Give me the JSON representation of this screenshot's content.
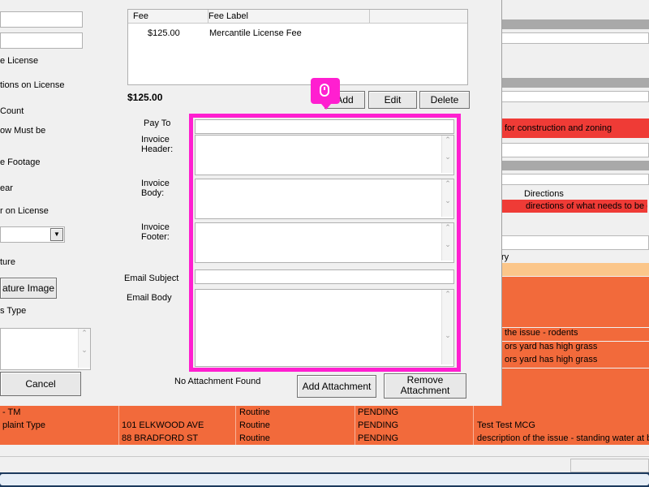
{
  "left_panel": {
    "labels": [
      "e License",
      "tions on License",
      "Count",
      "ow Must be",
      "e Footage",
      "ear",
      "r on License",
      "ture",
      "s Type"
    ],
    "feature_image_button": "ature Image",
    "cancel_button": "Cancel"
  },
  "fee_table": {
    "headers": [
      "Fee",
      "Fee Label",
      ""
    ],
    "rows": [
      {
        "fee": "$125.00",
        "label": "Mercantile License Fee"
      }
    ]
  },
  "total": "$125.00",
  "buttons": {
    "add": "Add",
    "edit": "Edit",
    "delete": "Delete",
    "add_attachment": "Add Attachment",
    "remove_attachment": "Remove Attachment"
  },
  "form": {
    "pay_to": "Pay To",
    "invoice_header": "Invoice Header:",
    "invoice_body": "Invoice Body:",
    "invoice_footer": "Invoice Footer:",
    "email_subject": "Email Subject",
    "email_body": "Email Body",
    "no_attachment": "No Attachment Found"
  },
  "right_panel": {
    "red_note": "for construction and zoning",
    "directions_header": "Directions",
    "directions_value": "directions of what needs to be g",
    "history_label": "ry",
    "issues": [
      "the issue - rodents",
      "ors yard has high grass",
      "ors yard has high grass"
    ]
  },
  "bottom_rows": [
    {
      "c1": "- TM",
      "c2": "",
      "c3": "Routine",
      "c4": "PENDING",
      "c5": ""
    },
    {
      "c1": "plaint Type",
      "c2": "101 ELKWOOD AVE",
      "c3": "Routine",
      "c4": "PENDING",
      "c5": "Test Test MCG"
    },
    {
      "c1": "",
      "c2": "88 BRADFORD ST",
      "c3": "Routine",
      "c4": "PENDING",
      "c5": "description of the issue - standing water at b"
    }
  ],
  "colors": {
    "highlight": "#ff1fd0",
    "row_orange": "#f26a3b",
    "red": "#ef3b36"
  },
  "icons": {
    "cursor": "mouse-icon"
  }
}
